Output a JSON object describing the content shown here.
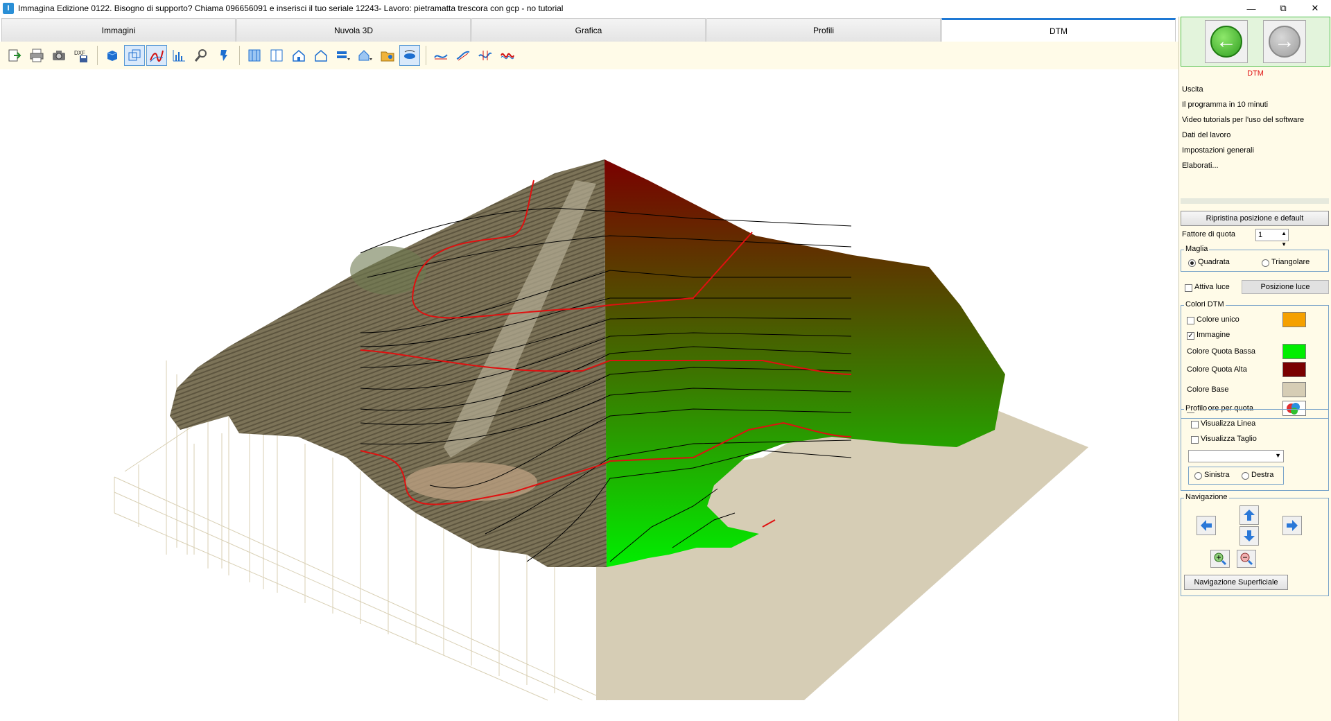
{
  "window": {
    "title": "Immagina  Edizione 0122. Bisogno di supporto? Chiama 096656091 e inserisci il tuo seriale 12243- Lavoro: pietramatta trescora con gcp - no tutorial",
    "app_icon": "app-icon",
    "controls": [
      "minimize-icon",
      "restore-icon",
      "close-icon"
    ]
  },
  "tabs": [
    {
      "label": "Immagini",
      "active": false
    },
    {
      "label": "Nuvola 3D",
      "active": false
    },
    {
      "label": "Grafica",
      "active": false
    },
    {
      "label": "Profili",
      "active": false
    },
    {
      "label": "DTM",
      "active": true
    }
  ],
  "toolbar": {
    "groups": [
      [
        "import-icon",
        "print-icon",
        "camera-icon",
        "dxf-save-icon"
      ],
      [
        "solid-cube-icon",
        "wire-cube-icon",
        "contour-lines-icon",
        "histogram-icon",
        "magnifier-icon",
        "pin-icon"
      ],
      [
        "split-view-icon",
        "panel-view-icon",
        "house-icon",
        "house-outline-icon",
        "layer-dropdown-icon",
        "home-dropdown-icon",
        "folder-icon",
        "rotate-view-icon"
      ],
      [
        "curve-1-icon",
        "curve-2-icon",
        "curve-3-icon",
        "curve-4-icon"
      ]
    ]
  },
  "panel": {
    "nav_back_icon": "back-arrow-icon",
    "nav_forward_icon": "forward-arrow-icon",
    "section_title": "DTM",
    "menu": [
      "Uscita",
      "Il programma in 10 minuti",
      "Video tutorials per l'uso del software",
      "Dati del lavoro",
      "Impostazioni generali",
      "Elaborati..."
    ],
    "reset_button": "Ripristina posizione e default",
    "height_factor_label": "Fattore di quota",
    "height_factor_value": "1",
    "mesh": {
      "legend": "Maglia",
      "options": [
        "Quadrata",
        "Triangolare"
      ],
      "selected": "Quadrata"
    },
    "light": {
      "checkbox_label": "Attiva luce",
      "checked": false,
      "position_button": "Posizione luce"
    },
    "colors": {
      "legend": "Colori DTM",
      "single_color_label": "Colore unico",
      "single_color_checked": false,
      "single_color": "#f5a000",
      "image_label": "Immagine",
      "image_checked": true,
      "low_label": "Colore Quota Bassa",
      "low_color": "#00ee00",
      "high_label": "Colore Quota Alta",
      "high_color": "#7a0000",
      "base_label": "Colore Base",
      "base_color": "#d6cdb5",
      "by_height_label": "Colore per quota",
      "by_height_checked": false,
      "by_height_icon": "color-wheel-icon"
    },
    "profile": {
      "legend": "Profilo",
      "show_line_label": "Visualizza Linea",
      "show_cut_label": "Visualizza Taglio",
      "combo_value": "",
      "left_label": "Sinistra",
      "right_label": "Destra"
    },
    "navigation": {
      "legend": "Navigazione",
      "surface_button": "Navigazione Superficiale"
    }
  },
  "viewport": {
    "low_color": "#00ee00",
    "high_color": "#7a0000",
    "base_color": "#d6cdb5",
    "contour_color": "#000000",
    "index_contour_color": "#e01010"
  }
}
